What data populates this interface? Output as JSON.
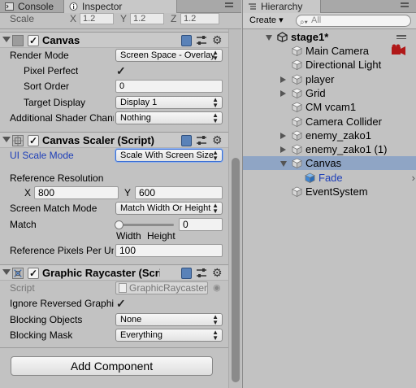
{
  "tabs": {
    "console": "Console",
    "inspector": "Inspector",
    "hierarchy": "Hierarchy"
  },
  "scale_row": {
    "label": "Scale",
    "x_axis": "X",
    "x_value": "1.2",
    "y_axis": "Y",
    "y_value": "1.2",
    "z_axis": "Z",
    "z_value": "1.2"
  },
  "canvas": {
    "title": "Canvas",
    "render_mode_label": "Render Mode",
    "render_mode_value": "Screen Space - Overlay",
    "pixel_perfect_label": "Pixel Perfect",
    "pixel_perfect_checked": true,
    "sort_order_label": "Sort Order",
    "sort_order_value": "0",
    "target_display_label": "Target Display",
    "target_display_value": "Display 1",
    "additional_shader_label": "Additional Shader Channels",
    "additional_shader_value": "Nothing"
  },
  "canvas_scaler": {
    "title": "Canvas Scaler (Script)",
    "ui_scale_mode_label": "UI Scale Mode",
    "ui_scale_mode_value": "Scale With Screen Size",
    "ref_resolution_label": "Reference Resolution",
    "x_label": "X",
    "x_value": "800",
    "y_label": "Y",
    "y_value": "600",
    "match_mode_label": "Screen Match Mode",
    "match_mode_value": "Match Width Or Height",
    "match_label": "Match",
    "match_value": "0",
    "match_slider": 0,
    "width_label": "Width",
    "height_label": "Height",
    "ref_pixels_label": "Reference Pixels Per Unit",
    "ref_pixels_value": "100"
  },
  "graphic_raycaster": {
    "title": "Graphic Raycaster (Script)",
    "script_label": "Script",
    "script_value": "GraphicRaycaster",
    "ignore_reversed_label": "Ignore Reversed Graphics",
    "ignore_reversed_checked": true,
    "blocking_objects_label": "Blocking Objects",
    "blocking_objects_value": "None",
    "blocking_mask_label": "Blocking Mask",
    "blocking_mask_value": "Everything"
  },
  "add_component_label": "Add Component",
  "hierarchy": {
    "create_label": "Create ▾",
    "search_placeholder": "All",
    "scene_name": "stage1*",
    "items": [
      {
        "label": "Main Camera",
        "indent": 1,
        "foldable": false,
        "selected": false
      },
      {
        "label": "Directional Light",
        "indent": 1,
        "foldable": false,
        "selected": false
      },
      {
        "label": "player",
        "indent": 1,
        "foldable": true,
        "selected": false
      },
      {
        "label": "Grid",
        "indent": 1,
        "foldable": true,
        "selected": false
      },
      {
        "label": "CM vcam1",
        "indent": 1,
        "foldable": false,
        "selected": false
      },
      {
        "label": "Camera Collider",
        "indent": 1,
        "foldable": false,
        "selected": false
      },
      {
        "label": "enemy_zako1",
        "indent": 1,
        "foldable": true,
        "selected": false
      },
      {
        "label": "enemy_zako1 (1)",
        "indent": 1,
        "foldable": true,
        "selected": false
      },
      {
        "label": "Canvas",
        "indent": 1,
        "foldable": true,
        "open": true,
        "selected": true
      },
      {
        "label": "Fade",
        "indent": 2,
        "foldable": false,
        "selected": false,
        "blue": true
      },
      {
        "label": "EventSystem",
        "indent": 1,
        "foldable": false,
        "selected": false
      }
    ]
  },
  "colors": {
    "panel_bg": "#c2c2c2",
    "selection": "#8fa5c5",
    "link_blue": "#1e3fb8",
    "focus_blue": "#3b6fd4"
  }
}
